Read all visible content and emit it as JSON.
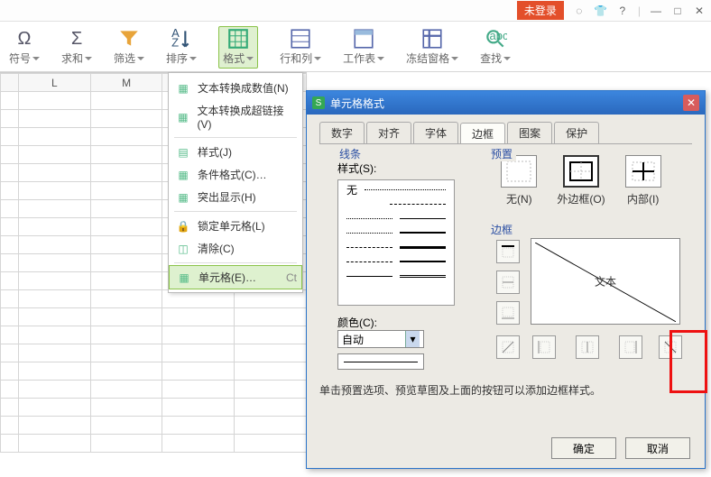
{
  "titlebar": {
    "nolog": "未登录"
  },
  "ribbon": {
    "symbol": "符号",
    "sum": "求和",
    "filter": "筛选",
    "sort": "排序",
    "format": "格式",
    "rowcol": "行和列",
    "sheet": "工作表",
    "freeze": "冻结窗格",
    "find": "查找"
  },
  "menu": {
    "items": [
      "文本转换成数值(N)",
      "文本转换成超链接(V)",
      "样式(J)",
      "条件格式(C)…",
      "突出显示(H)",
      "锁定单元格(L)",
      "清除(C)",
      "单元格(E)…"
    ],
    "shortcut": "Ct"
  },
  "dialog": {
    "title": "单元格格式",
    "tabs": [
      "数字",
      "对齐",
      "字体",
      "边框",
      "图案",
      "保护"
    ],
    "active_tab": "边框",
    "line_group": "线条",
    "style_label": "样式(S):",
    "none": "无",
    "color_label": "颜色(C):",
    "color_value": "自动",
    "preset_group": "预置",
    "presets": {
      "none": "无(N)",
      "outer": "外边框(O)",
      "inner": "内部(I)"
    },
    "border_group": "边框",
    "preview_text": "文本",
    "hint": "单击预置选项、预览草图及上面的按钮可以添加边框样式。",
    "ok": "确定",
    "cancel": "取消"
  },
  "cols": [
    "L",
    "M"
  ]
}
